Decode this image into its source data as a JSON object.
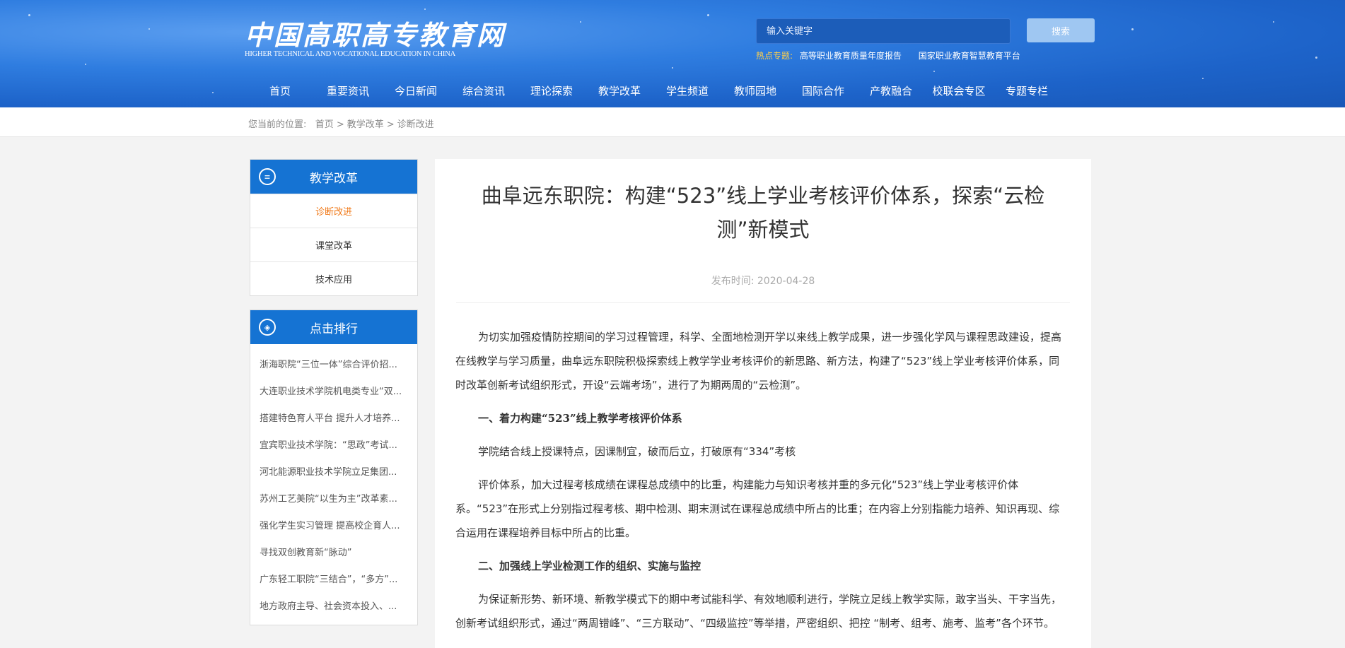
{
  "header": {
    "logo_cn": "中国高职高专教育网",
    "logo_en": "HIGHER TECHNICAL AND VOCATIONAL EDUCATION IN CHINA",
    "search_placeholder": "输入关键字",
    "search_button": "搜索",
    "hot_label": "热点专题:",
    "hot_links": [
      "高等职业教育质量年度报告",
      "国家职业教育智慧教育平台"
    ]
  },
  "nav": [
    "首页",
    "重要资讯",
    "今日新闻",
    "综合资讯",
    "理论探索",
    "教学改革",
    "学生频道",
    "教师园地",
    "国际合作",
    "产教融合",
    "校联会专区",
    "专题专栏"
  ],
  "breadcrumb": {
    "prefix": "您当前的位置:",
    "items": [
      "首页",
      "教学改革",
      "诊断改进"
    ],
    "separator": ">"
  },
  "sidebar": {
    "category_title": "教学改革",
    "category_items": [
      "诊断改进",
      "课堂改革",
      "技术应用"
    ],
    "ranking_title": "点击排行",
    "ranking_items": [
      "浙海职院“三位一体”综合评价招...",
      "大连职业技术学院机电类专业“双...",
      "搭建特色育人平台 提升人才培养...",
      "宜宾职业技术学院：“思政”考试...",
      "河北能源职业技术学院立足集团...",
      "苏州工艺美院“以生为主”改革素...",
      "强化学生实习管理 提高校企育人...",
      "寻找双创教育新“脉动”",
      "广东轻工职院“三结合”，“多方”...",
      "地方政府主导、社会资本投入、..."
    ]
  },
  "article": {
    "title": "曲阜远东职院：构建“523”线上学业考核评价体系，探索“云检测”新模式",
    "date_label": "发布时间:",
    "date": "2020-04-28",
    "paragraphs": [
      "为切实加强疫情防控期间的学习过程管理，科学、全面地检测开学以来线上教学成果，进一步强化学风与课程思政建设，提高在线教学与学习质量，曲阜远东职院积极探索线上教学学业考核评价的新思路、新方法，构建了“523”线上学业考核评价体系，同时改革创新考试组织形式，开设“云端考场”，进行了为期两周的“云检测”。",
      "一、着力构建“523”线上教学考核评价体系",
      "学院结合线上授课特点，因课制宜，破而后立，打破原有“334”考核",
      "评价体系，加大过程考核成绩在课程总成绩中的比重，构建能力与知识考核并重的多元化“523”线上学业考核评价体系。“523”在形式上分别指过程考核、期中检测、期末测试在课程总成绩中所占的比重；在内容上分别指能力培养、知识再现、综合运用在课程培养目标中所占的比重。",
      "二、加强线上学业检测工作的组织、实施与监控",
      "为保证新形势、新环境、新教学模式下的期中考试能科学、有效地顺利进行，学院立足线上教学实际，敢字当头、干字当先，创新考试组织形式，通过“两周错峰”、“三方联动”、“四级监控”等举措，严密组织、把控 “制考、组考、施考、监考”各个环节。"
    ]
  },
  "colors": {
    "accent": "#1573d3",
    "active": "#f07a1a",
    "hot": "#ffd04a"
  }
}
